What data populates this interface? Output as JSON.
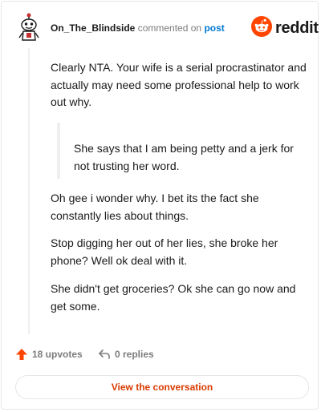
{
  "header": {
    "username": "On_The_Blindside",
    "action_text": "commented on",
    "post_link": "post",
    "brand": "reddit"
  },
  "comment": {
    "paragraph_1": "Clearly NTA. Your wife is a serial procrastinator and actually may need some professional help to work out why.",
    "quote": "She says that I am being petty and a jerk for not trusting her word.",
    "paragraph_2": "Oh gee i wonder why. I bet its the fact she constantly lies about things.",
    "paragraph_3": "Stop digging her out of her lies, she broke her phone? Well ok deal with it.",
    "paragraph_4": "She didn't get groceries? Ok she can go now and get some."
  },
  "footer": {
    "upvotes": "18 upvotes",
    "replies": "0 replies",
    "cta": "View the conversation"
  },
  "icons": {
    "avatar": "snoo-avatar-icon",
    "brand": "reddit-logo-icon",
    "upvote": "upvote-arrow-icon",
    "reply": "reply-arrow-icon"
  },
  "colors": {
    "brand_orange": "#ff4500",
    "link_blue": "#0079d3",
    "cta_text": "#d93a00",
    "text": "#1a1a1b",
    "muted": "#7c7c7c"
  }
}
